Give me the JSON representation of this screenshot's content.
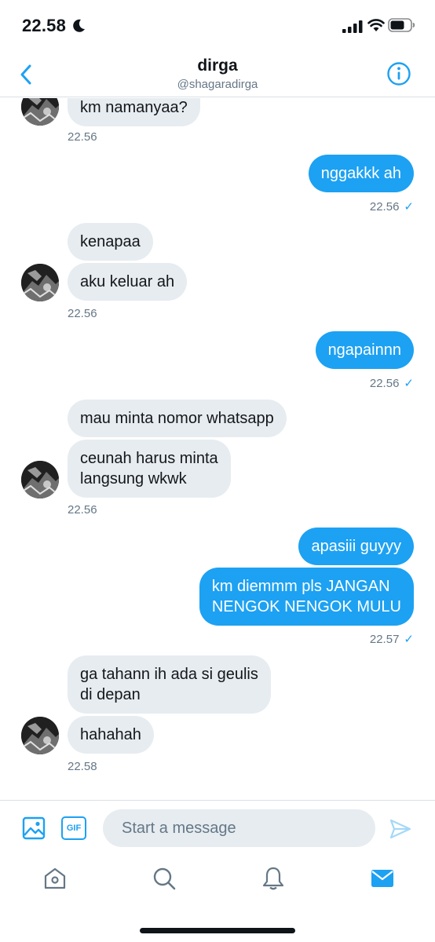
{
  "status_bar": {
    "time": "22.58"
  },
  "header": {
    "name": "dirga",
    "handle": "@shagaradirga"
  },
  "messages": [
    {
      "text": "km namanyaa?",
      "time": "22.56"
    },
    {
      "text": "nggakkk ah",
      "time": "22.56"
    },
    {
      "text": "kenapaa"
    },
    {
      "text": "aku keluar ah",
      "time": "22.56"
    },
    {
      "text": "ngapainnn",
      "time": "22.56"
    },
    {
      "text": "mau minta nomor whatsapp"
    },
    {
      "text": "ceunah harus minta\nlangsung wkwk",
      "time": "22.56"
    },
    {
      "text": "apasiii guyyy"
    },
    {
      "text": "km diemmm pls JANGAN\nNENGOK NENGOK MULU",
      "time": "22.57"
    },
    {
      "text": "ga tahann ih ada si geulis\ndi depan"
    },
    {
      "text": "hahahah",
      "time": "22.58"
    }
  ],
  "composer": {
    "placeholder": "Start a message",
    "gif_label": "GIF"
  },
  "icons": {
    "back": "chevron-left-icon",
    "info": "info-icon",
    "media": "image-icon",
    "send": "send-icon",
    "tabs": [
      "home-icon",
      "search-icon",
      "bell-icon",
      "mail-icon"
    ]
  },
  "colors": {
    "accent": "#1da1f2",
    "incoming_bubble": "#e6ecf0",
    "muted_text": "#657786"
  }
}
